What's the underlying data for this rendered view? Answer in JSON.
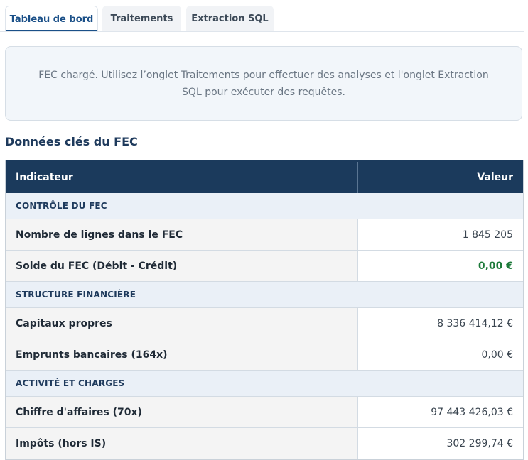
{
  "tabs": [
    {
      "label": "Tableau de bord",
      "active": true
    },
    {
      "label": "Traitements",
      "active": false
    },
    {
      "label": "Extraction SQL",
      "active": false
    }
  ],
  "notice": {
    "text": "FEC chargé. Utilisez l’onglet Traitements pour effectuer des analyses et l'onglet Extraction SQL pour exécuter des requêtes."
  },
  "section_title": "Données clés du FEC",
  "table": {
    "headers": {
      "indicator": "Indicateur",
      "value": "Valeur"
    },
    "groups": [
      {
        "label": "CONTRÔLE DU FEC",
        "rows": [
          {
            "label": "Nombre de lignes dans le FEC",
            "value": "1 845 205"
          },
          {
            "label": "Solde du FEC (Débit - Crédit)",
            "value": "0,00 €"
          }
        ]
      },
      {
        "label": "STRUCTURE FINANCIÈRE",
        "rows": [
          {
            "label": "Capitaux propres",
            "value": "8 336 414,12 €"
          },
          {
            "label": "Emprunts bancaires (164x)",
            "value": "0,00 €"
          }
        ]
      },
      {
        "label": "ACTIVITÉ ET CHARGES",
        "rows": [
          {
            "label": "Chiffre d'affaires (70x)",
            "value": "97 443 426,03 €"
          },
          {
            "label": "Impôts (hors IS)",
            "value": "302 299,74 €"
          }
        ]
      }
    ]
  },
  "colors": {
    "accent": "#1b5088",
    "header_bg": "#1b3a5c",
    "positive": "#1d7a3a"
  }
}
